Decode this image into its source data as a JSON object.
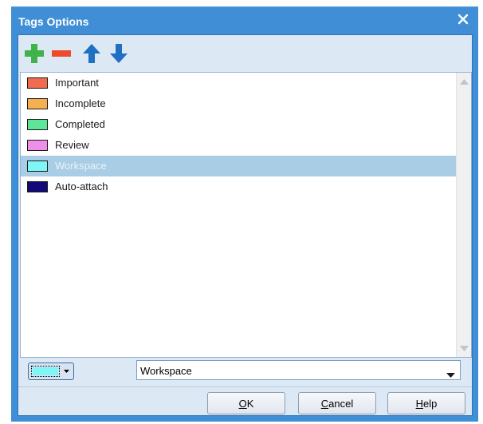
{
  "window": {
    "title": "Tags Options"
  },
  "toolbar": {
    "items": [
      "add-icon",
      "remove-icon",
      "move-up-icon",
      "move-down-icon"
    ]
  },
  "tags": [
    {
      "label": "Important",
      "color": "#f26a4f"
    },
    {
      "label": "Incomplete",
      "color": "#f7b04f"
    },
    {
      "label": "Completed",
      "color": "#5ee59a"
    },
    {
      "label": "Review",
      "color": "#f08fe8"
    },
    {
      "label": "Workspace",
      "color": "#7ef6f6",
      "selected": true
    },
    {
      "label": "Auto-attach",
      "color": "#130a7a"
    }
  ],
  "editor": {
    "color": "#7ef6f6",
    "name_value": "Workspace"
  },
  "buttons": {
    "ok_first": "O",
    "ok_rest": "K",
    "cancel_first": "C",
    "cancel_rest": "ancel",
    "help_first": "H",
    "help_rest": "elp"
  },
  "colors": {
    "titlebar": "#3f8ed6",
    "client": "#dde8f5",
    "selection": "#a8cde4"
  }
}
